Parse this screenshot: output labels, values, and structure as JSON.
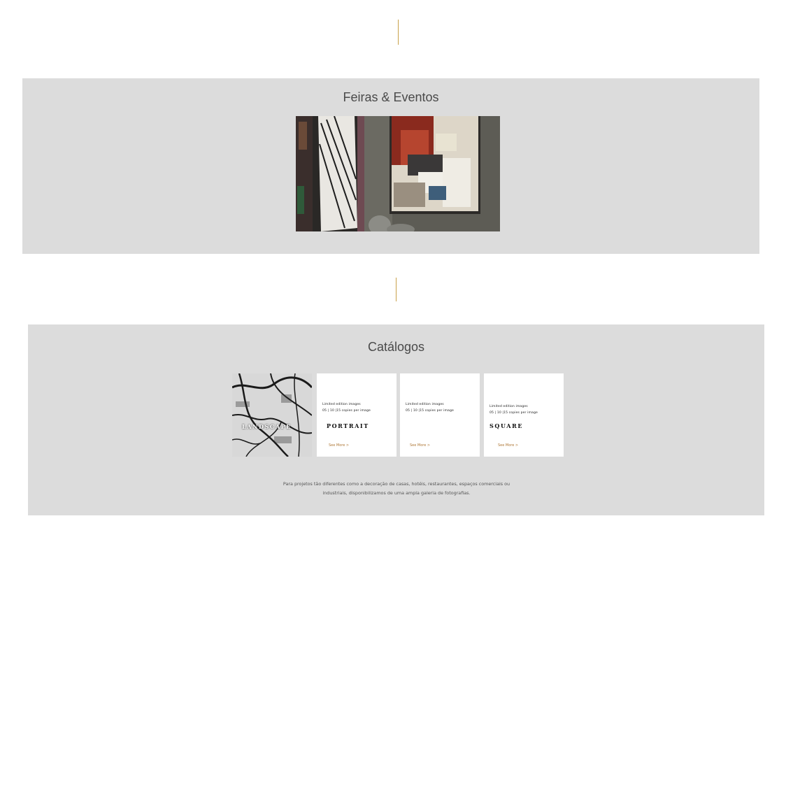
{
  "sections": {
    "events": {
      "title": "Feiras & Eventos"
    },
    "catalogs": {
      "title": "Catálogos",
      "cards": [
        {
          "name": "LANDSCAPE"
        },
        {
          "line1": "Limited edition images",
          "line2": "05 | 10 |15 copies per image",
          "name": "PORTRAIT",
          "link": "See More >"
        },
        {
          "line1": "Limited edition images",
          "line2": "05 | 10 |15 copies per image",
          "link": "See More >"
        },
        {
          "line1": "Limited edition images",
          "line2": "05 | 10 |15 copies per image",
          "name": "SQUARE",
          "link": "See More >"
        }
      ],
      "description_line1": "Para projetos tão diferentes como a decoração de casas, hotéis, restaurantes, espaços comerciais ou",
      "description_line2": "industriais, disponibilizamos de uma ampla galeria de fotografias."
    }
  },
  "colors": {
    "accent_line": "#c9a14a",
    "section_bg": "#dcdcdc",
    "link": "#b07a3a"
  }
}
